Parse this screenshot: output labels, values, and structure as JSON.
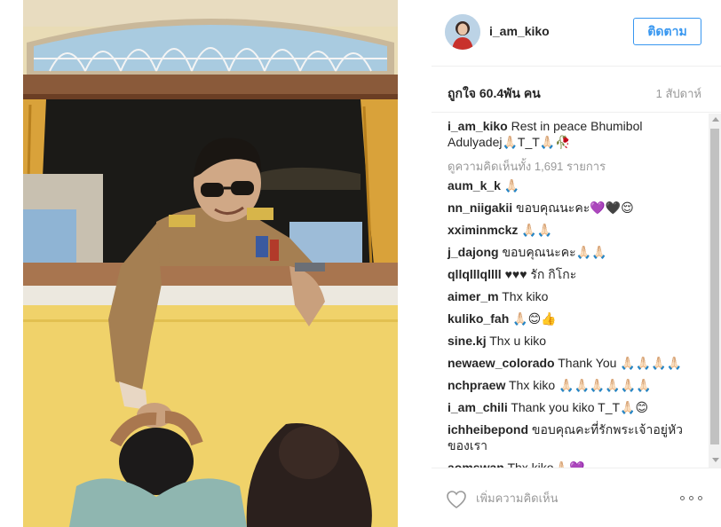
{
  "post": {
    "username": "i_am_kiko",
    "follow_label": "ติดตาม",
    "likes": "ถูกใจ 60.4พัน คน",
    "time_ago": "1 สัปดาห์",
    "caption_author": "i_am_kiko",
    "caption_text": "Rest in peace Bhumibol Adulyadej🙏🏻T_T🙏🏻🥀",
    "view_all": "ดูความคิดเห็นทั้ง 1,691 รายการ",
    "add_comment_placeholder": "เพิ่มความคิดเห็น"
  },
  "comments": [
    {
      "author": "aum_k_k",
      "text": "🙏🏻"
    },
    {
      "author": "nn_niigakii",
      "text": "ขอบคุณนะคะ💜🖤😌"
    },
    {
      "author": "xximinmckz",
      "text": "🙏🏻🙏🏻"
    },
    {
      "author": "j_dajong",
      "text": "ขอบคุณนะคะ🙏🏻🙏🏻"
    },
    {
      "author": "qllqlllqllll",
      "text": "♥♥♥ รัก กิโกะ"
    },
    {
      "author": "aimer_m",
      "text": "Thx kiko"
    },
    {
      "author": "kuliko_fah",
      "text": "🙏🏻😊👍"
    },
    {
      "author": "sine.kj",
      "text": "Thx u kiko"
    },
    {
      "author": "newaew_colorado",
      "text": "Thank You 🙏🏻🙏🏻🙏🏻🙏🏻"
    },
    {
      "author": "nchpraew",
      "text": "Thx kiko 🙏🏻🙏🏻🙏🏻🙏🏻🙏🏻🙏🏻"
    },
    {
      "author": "i_am_chili",
      "text": "Thank you kiko T_T🙏🏻😊"
    },
    {
      "author": "ichheibepond",
      "text": "ขอบคุณคะที่รักพระเจ้าอยู่หัวของเรา"
    },
    {
      "author": "aomswan",
      "text": "Thx kiko🙏🏻💜"
    }
  ],
  "icons": {
    "heart": "heart-outline-icon",
    "more": "more-options-icon",
    "scroll_up": "scroll-up-arrow-icon",
    "scroll_down": "scroll-down-arrow-icon"
  },
  "colors": {
    "accent": "#3897f0",
    "text": "#262626",
    "muted": "#999999",
    "border": "#efefef"
  }
}
